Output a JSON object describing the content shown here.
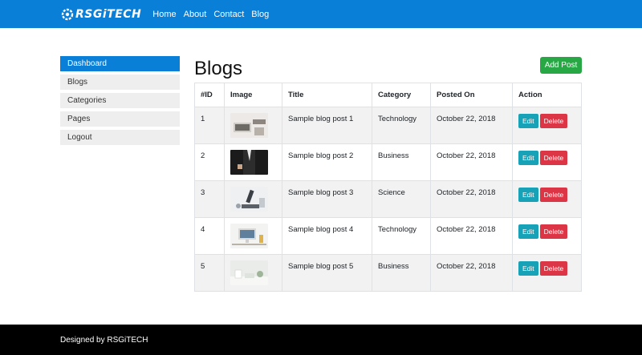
{
  "navbar": {
    "brand": "RSGiTECH",
    "links": [
      "Home",
      "About",
      "Contact",
      "Blog"
    ],
    "color": "#0a7fd8"
  },
  "sidebar": {
    "items": [
      {
        "label": "Dashboard",
        "active": true
      },
      {
        "label": "Blogs"
      },
      {
        "label": "Categories"
      },
      {
        "label": "Pages"
      },
      {
        "label": "Logout"
      }
    ]
  },
  "main": {
    "title": "Blogs",
    "add_button": "Add Post",
    "columns": [
      "#ID",
      "Image",
      "Title",
      "Category",
      "Posted On",
      "Action"
    ],
    "rows": [
      {
        "id": "1",
        "title": "Sample blog post 1",
        "category": "Technology",
        "posted": "October 22, 2018",
        "image": "desk-laptop-photo"
      },
      {
        "id": "2",
        "title": "Sample blog post 2",
        "category": "Business",
        "posted": "October 22, 2018",
        "image": "businessman-photo"
      },
      {
        "id": "3",
        "title": "Sample blog post 3",
        "category": "Science",
        "posted": "October 22, 2018",
        "image": "microscope-photo"
      },
      {
        "id": "4",
        "title": "Sample blog post 4",
        "category": "Technology",
        "posted": "October 22, 2018",
        "image": "imac-desk-photo"
      },
      {
        "id": "5",
        "title": "Sample blog post 5",
        "category": "Business",
        "posted": "October 22, 2018",
        "image": "office-supplies-photo"
      }
    ],
    "edit_label": "Edit",
    "delete_label": "Delete"
  },
  "footer": {
    "text": "Designed by RSGiTECH"
  },
  "colors": {
    "primary": "#0a7fd8",
    "success": "#28a745",
    "info": "#17a2b8",
    "danger": "#dc3545"
  }
}
